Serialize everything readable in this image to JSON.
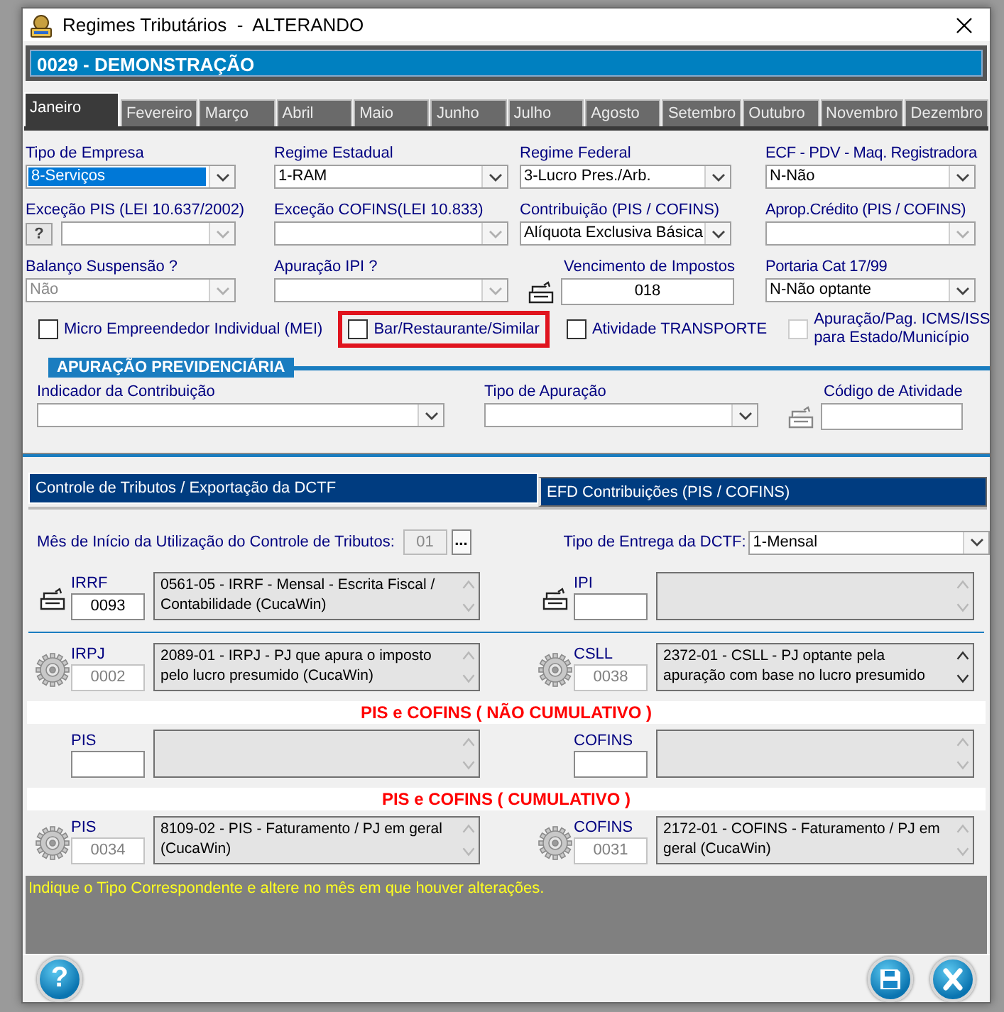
{
  "window": {
    "title": "Regimes Tributários  -  ALTERANDO"
  },
  "company": "0029 - DEMONSTRAÇÃO",
  "months": [
    {
      "label": "Janeiro",
      "selected": true
    },
    {
      "label": "Fevereiro",
      "selected": false
    },
    {
      "label": "Março",
      "selected": false
    },
    {
      "label": "Abril",
      "selected": false
    },
    {
      "label": "Maio",
      "selected": false
    },
    {
      "label": "Junho",
      "selected": false
    },
    {
      "label": "Julho",
      "selected": false
    },
    {
      "label": "Agosto",
      "selected": false
    },
    {
      "label": "Setembro",
      "selected": false
    },
    {
      "label": "Outubro",
      "selected": false
    },
    {
      "label": "Novembro",
      "selected": false
    },
    {
      "label": "Dezembro",
      "selected": false
    }
  ],
  "form_fields": [
    {
      "kind": "combo",
      "label": "Tipo de Empresa",
      "value": "8-Serviços",
      "disabled": false,
      "focused": true
    },
    {
      "kind": "combo",
      "label": "Regime Estadual",
      "value": "1-RAM",
      "disabled": false,
      "focused": false
    },
    {
      "kind": "combo",
      "label": "Regime Federal",
      "value": "3-Lucro Pres./Arb.",
      "disabled": false,
      "focused": false
    },
    {
      "kind": "combo",
      "label": "ECF - PDV - Maq. Registradora",
      "value": "N-Não",
      "disabled": false,
      "focused": false
    },
    {
      "kind": "help_combo",
      "label": "Exceção PIS (LEI 10.637/2002)",
      "button": "?",
      "disabled": true,
      "focused": false
    },
    {
      "kind": "combo",
      "label": "Exceção COFINS(LEI 10.833)",
      "disabled": true,
      "focused": false
    },
    {
      "kind": "combo",
      "label": "Contribuição (PIS / COFINS)",
      "value": "Alíquota Exclusiva Básica",
      "disabled": false,
      "focused": false
    },
    {
      "kind": "combo",
      "label": "Aprop.Crédito (PIS / COFINS)",
      "disabled": true,
      "focused": false
    },
    {
      "kind": "combo",
      "label": "Balanço Suspensão ?",
      "value": "Não",
      "disabled": true,
      "focused": false
    },
    {
      "kind": "combo",
      "label": "Apuração IPI ?",
      "disabled": true,
      "focused": false
    },
    {
      "kind": "icon_text",
      "label": "Vencimento de Impostos",
      "value": "018"
    },
    {
      "kind": "combo",
      "label": "Portaria Cat 17/99",
      "value": "N-Não optante",
      "disabled": false,
      "focused": false
    }
  ],
  "checkboxes": [
    {
      "label": "Micro Empreendedor Individual (MEI)",
      "checked": false,
      "disabled": false,
      "highlighted": false
    },
    {
      "label": "Bar/Restaurante/Similar",
      "checked": false,
      "disabled": false,
      "highlighted": true
    },
    {
      "label": "Atividade TRANSPORTE",
      "checked": false,
      "disabled": false,
      "highlighted": false
    },
    {
      "label": "Apuração/Pag. ICMS/ISS para Estado/Município",
      "checked": false,
      "disabled": true,
      "highlighted": false
    }
  ],
  "previdenciaria": {
    "title": "APURAÇÃO PREVIDENCIÁRIA",
    "fields": [
      {
        "kind": "combo",
        "label": "Indicador da Contribuição",
        "disabled": false,
        "focused": false
      },
      {
        "kind": "combo",
        "label": "Tipo de Apuração",
        "disabled": false,
        "focused": false
      },
      {
        "kind": "icon_text",
        "label": "Código de Atividade"
      }
    ]
  },
  "tabs": [
    {
      "label": "Controle de Tributos / Exportação da DCTF",
      "selected": true
    },
    {
      "label": "EFD Contribuições (PIS / COFINS)",
      "selected": false
    }
  ],
  "start_month": {
    "label": "Mês de Início da Utilização do Controle de Tributos:",
    "value": "01",
    "disabled": true,
    "button": "..."
  },
  "delivery_type": {
    "label": "Tipo de Entrega da DCTF:",
    "value": "1-Mensal",
    "disabled": false,
    "focused": false
  },
  "tax_groups": [
    {
      "entries": [
        {
          "label": "IRRF",
          "kind": "tray",
          "code": "0093",
          "description": "0561-05 - IRRF - Mensal - Escrita Fiscal / Contabilidade (CucaWin)",
          "disabled": false,
          "scrollable": false
        },
        {
          "label": "IPI",
          "kind": "tray",
          "disabled": false,
          "scrollable": false
        }
      ]
    },
    {
      "entries": [
        {
          "label": "IRPJ",
          "kind": "gear",
          "code": "0002",
          "description": "2089-01 - IRPJ - PJ que apura o imposto pelo lucro presumido (CucaWin)",
          "disabled": true,
          "scrollable": false
        },
        {
          "label": "CSLL",
          "kind": "gear",
          "code": "0038",
          "description": "2372-01 - CSLL - PJ optante pela apuração com base no lucro presumido",
          "disabled": true,
          "scrollable": true
        }
      ]
    },
    {
      "heading": "PIS e COFINS ( NÃO CUMULATIVO )",
      "entries": [
        {
          "label": "PIS",
          "kind": "plain",
          "disabled": false,
          "scrollable": false
        },
        {
          "label": "COFINS",
          "kind": "plain",
          "disabled": false,
          "scrollable": false
        }
      ]
    },
    {
      "heading": "PIS e COFINS ( CUMULATIVO )",
      "entries": [
        {
          "label": "PIS",
          "kind": "gear",
          "code": "0034",
          "description": "8109-02 - PIS - Faturamento / PJ em geral (CucaWin)",
          "disabled": true,
          "scrollable": false
        },
        {
          "label": "COFINS",
          "kind": "gear",
          "code": "0031",
          "description": "2172-01 - COFINS - Faturamento / PJ em geral (CucaWin)",
          "disabled": true,
          "scrollable": false
        }
      ]
    }
  ],
  "hint": "Indique o Tipo Correspondente e altere no mês em que houver alterações.",
  "footer": {
    "help": "?"
  }
}
